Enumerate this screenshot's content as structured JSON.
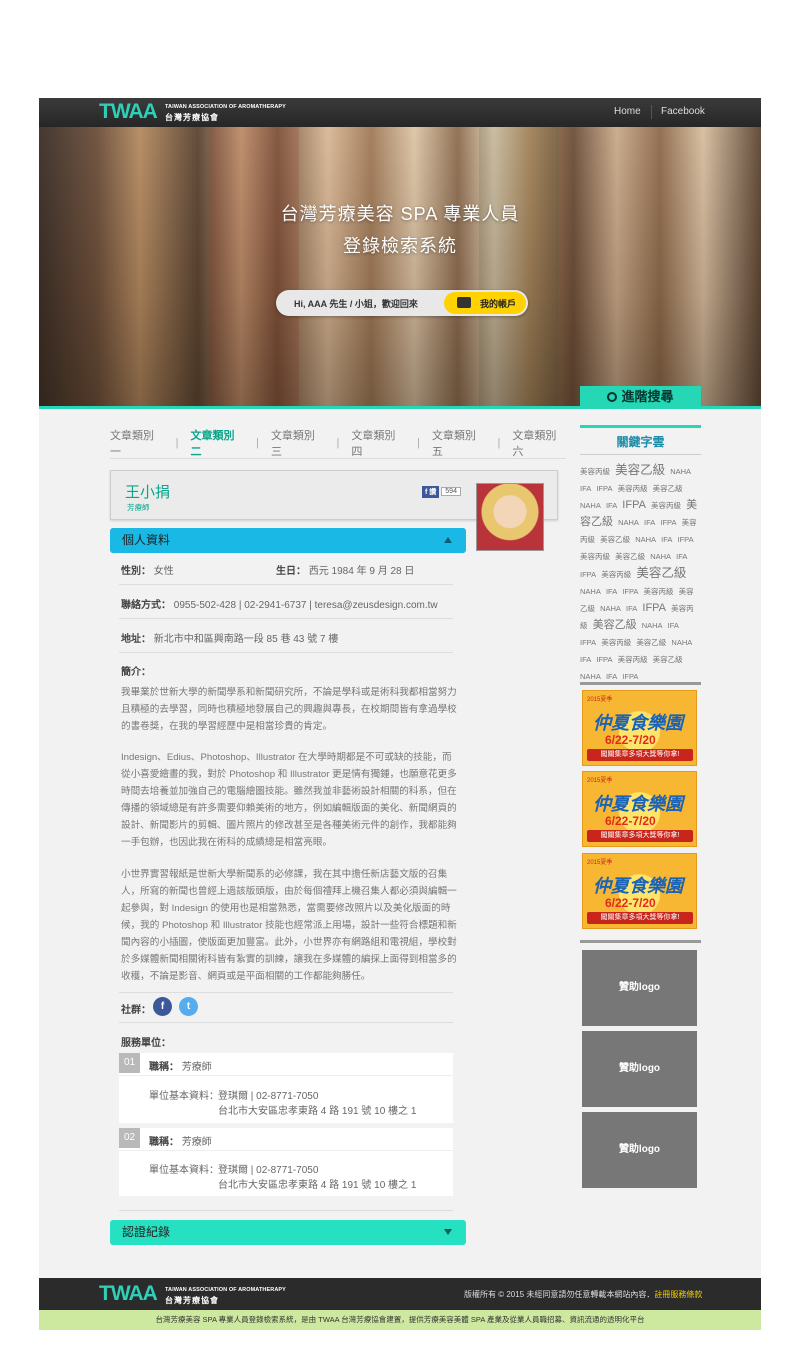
{
  "brand": {
    "mark": "TWAA",
    "en": "TAIWAN ASSOCIATION OF AROMATHERAPY",
    "zh": "台灣芳療協會"
  },
  "nav": {
    "home": "Home",
    "facebook": "Facebook"
  },
  "hero": {
    "title_line1": "台灣芳療美容 SPA 專業人員",
    "title_line2": "登錄檢索系統",
    "welcome": "Hi, AAA 先生 / 小姐，歡迎回來",
    "account": "我的帳戶",
    "advanced_search": "進階搜尋"
  },
  "categories": [
    "文章類別一",
    "文章類別二",
    "文章類別三",
    "文章類別四",
    "文章類別五",
    "文章類別六"
  ],
  "active_category_index": 1,
  "profile": {
    "name": "王小捐",
    "title": "芳療師",
    "fb_like": "讚",
    "fb_count": "594",
    "personal_section": "個人資料",
    "gender_label": "性別：",
    "gender": "女性",
    "birthday_label": "生日：",
    "birthday": "西元 1984 年 9 月 28 日",
    "contact_label": "聯絡方式：",
    "contact": "0955-502-428  |  02-2941-6737  |  teresa@zeusdesign.com.tw",
    "address_label": "地址：",
    "address": "新北市中和區興南路一段 85 巷 43 號 7 樓",
    "intro_label": "簡介：",
    "intro_p1": "我畢業於世新大學的新聞學系和新聞研究所，不論是學科或是術科我都相當努力且積極的去學習，同時也積極地發展自己的興趣與專長，在校期間皆有拿過學校的書卷獎，在我的學習經歷中是相當珍貴的肯定。",
    "intro_p2": "Indesign、Edius、Photoshop、Illustrator 在大學時期都是不可或缺的技能，而從小喜愛繪畫的我，對於 Photoshop 和 Illustrator 更是情有獨鍾，也願意花更多時間去培養並加強自己的電腦繪圖技能。雖然我並非藝術設計相關的科系，但在傳播的領域總是有許多需要仰賴美術的地方，例如編輯版面的美化、新聞網頁的設計、新聞影片的剪輯、圖片照片的修改甚至是各種美術元件的創作，我都能夠一手包辦，也因此我在術科的成績總是相當亮眼。",
    "intro_p3": "小世界實習報紙是世新大學新聞系的必修課，我在其中擔任新店藝文版的召集人，所寫的新聞也曾經上過該版頭版，由於每個禮拜上機召集人都必須與編輯一起參與，對 Indesign 的使用也是相當熟悉，當需要修改照片以及美化版面的時候，我的 Photoshop 和 Illustrator 技能也經常派上用場，設計一些符合標題和新聞內容的小插圖，使版面更加豐富。此外，小世界亦有網路組和電視組，學校對於多媒體新聞相關術科皆有紮實的訓練，讓我在多媒體的編採上面得到相當多的收穫，不論是影音、網頁或是平面相關的工作都能夠勝任。",
    "social_label": "社群：",
    "social_fb": "f",
    "social_tw": "t",
    "service_label": "服務單位：",
    "services": [
      {
        "num": "01",
        "role_label": "職稱：",
        "role": "芳療師",
        "info_label": "單位基本資料：",
        "line1": "登琪爾  |  02-8771-7050",
        "line2": "台北市大安區忠孝東路 4 路 191 號 10 樓之 1"
      },
      {
        "num": "02",
        "role_label": "職稱：",
        "role": "芳療師",
        "info_label": "單位基本資料：",
        "line1": "登琪爾  |  02-8771-7050",
        "line2": "台北市大安區忠孝東路 4 路 191 號 10 樓之 1"
      }
    ],
    "cert_section": "認證紀錄"
  },
  "sidebar": {
    "keyword_title": "關鍵字雲",
    "keywords": [
      [
        "美容丙級",
        "s"
      ],
      [
        "美容乙級",
        "l"
      ],
      [
        "NAHA",
        "s"
      ],
      [
        "IFA",
        "s"
      ],
      [
        "IFPA",
        "s"
      ],
      [
        "美容丙級",
        "s"
      ],
      [
        "美容乙級",
        "s"
      ],
      [
        "NAHA",
        "s"
      ],
      [
        "IFA",
        "s"
      ],
      [
        "IFPA",
        "m"
      ],
      [
        "美容丙級",
        "s"
      ],
      [
        "美容乙級",
        "m"
      ],
      [
        "NAHA",
        "s"
      ],
      [
        "IFA",
        "s"
      ],
      [
        "IFPA",
        "s"
      ],
      [
        "美容丙級",
        "s"
      ],
      [
        "美容乙級",
        "s"
      ],
      [
        "NAHA",
        "s"
      ],
      [
        "IFA",
        "s"
      ],
      [
        "IFPA",
        "s"
      ],
      [
        "美容丙級",
        "s"
      ],
      [
        "美容乙級",
        "s"
      ],
      [
        "NAHA",
        "s"
      ],
      [
        "IFA",
        "s"
      ],
      [
        "IFPA",
        "s"
      ],
      [
        "美容丙級",
        "s"
      ],
      [
        "美容乙級",
        "l"
      ],
      [
        "NAHA",
        "s"
      ],
      [
        "IFA",
        "s"
      ],
      [
        "IFPA",
        "s"
      ],
      [
        "美容丙級",
        "s"
      ],
      [
        "美容乙級",
        "s"
      ],
      [
        "NAHA",
        "s"
      ],
      [
        "IFA",
        "s"
      ],
      [
        "IFPA",
        "m"
      ],
      [
        "美容丙級",
        "s"
      ],
      [
        "美容乙級",
        "m"
      ],
      [
        "NAHA",
        "s"
      ],
      [
        "IFA",
        "s"
      ],
      [
        "IFPA",
        "s"
      ],
      [
        "美容丙級",
        "s"
      ],
      [
        "美容乙級",
        "s"
      ],
      [
        "NAHA",
        "s"
      ],
      [
        "IFA",
        "s"
      ],
      [
        "IFPA",
        "s"
      ],
      [
        "美容丙級",
        "s"
      ],
      [
        "美容乙級",
        "s"
      ],
      [
        "NAHA",
        "s"
      ],
      [
        "IFA",
        "s"
      ],
      [
        "IFPA",
        "s"
      ]
    ],
    "banner": {
      "top": "2015夏季",
      "welcome": "仲夏食樂園",
      "date": "6/22-7/20",
      "bottom": "闖關集章多項大獎等你拿!"
    },
    "sponsors": [
      "贊助logo",
      "贊助logo",
      "贊助logo"
    ]
  },
  "footer": {
    "copyright": "版權所有 © 2015 未經同意請勿任意轉載本網站內容．",
    "terms": "註冊服務條款",
    "bottom": "台灣芳療美容 SPA 專業人員登錄檢索系統，是由 TWAA 台灣芳療協會建置，提供芳療美容美體 SPA 產業及從業人員職招募、資訊流通的透明化平台"
  }
}
